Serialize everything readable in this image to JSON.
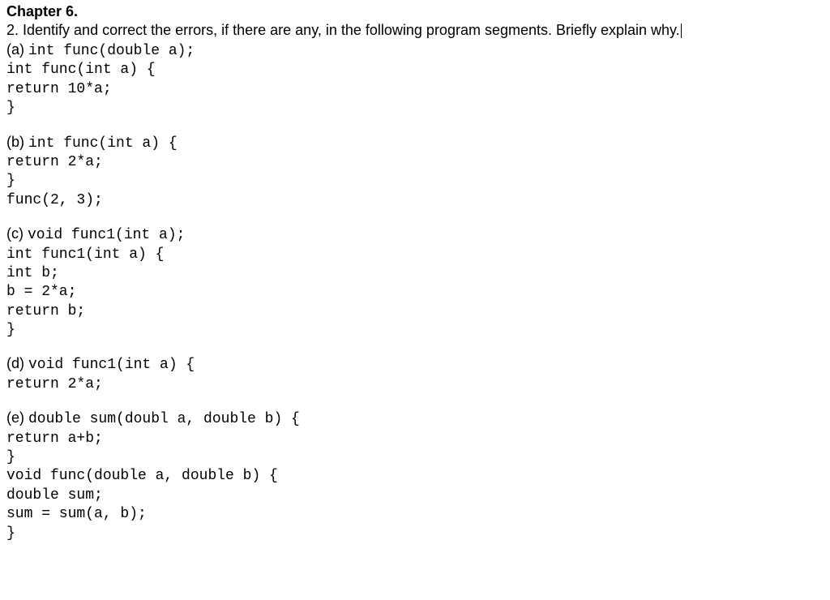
{
  "chapter_title": "Chapter 6.",
  "question": "2. Identify and correct the errors, if there are any, in the following program segments. Briefly explain why.",
  "segments": [
    {
      "label": "(a) ",
      "lines": [
        "int func(double a);",
        "int func(int a) {",
        "return 10*a;",
        "}"
      ]
    },
    {
      "label": "(b) ",
      "lines": [
        "int func(int a) {",
        "return 2*a;",
        "}",
        "func(2, 3);"
      ]
    },
    {
      "label": "(c) ",
      "lines": [
        "void func1(int a);",
        "int func1(int a) {",
        "int b;",
        "b = 2*a;",
        "return b;",
        "}"
      ]
    },
    {
      "label": "(d) ",
      "lines": [
        "void func1(int a) {",
        "return 2*a;"
      ]
    },
    {
      "label": "(e) ",
      "lines": [
        "double sum(doubl a, double b) {",
        "return a+b;",
        "}",
        "void func(double a, double b) {",
        "double sum;",
        "sum = sum(a, b);",
        "}"
      ]
    }
  ]
}
